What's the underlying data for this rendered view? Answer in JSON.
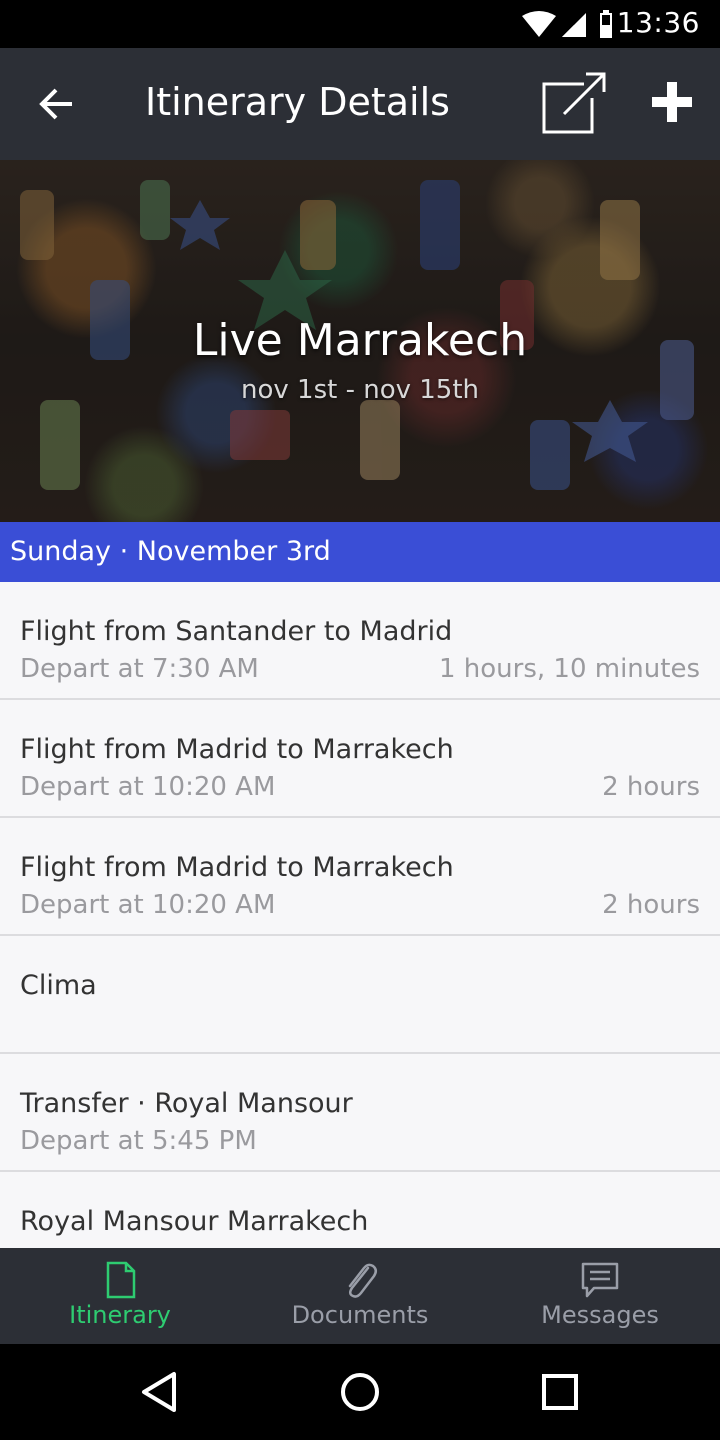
{
  "status_bar": {
    "time": "13:36",
    "icons": [
      "wifi-icon",
      "signal-icon",
      "battery-icon"
    ]
  },
  "app_bar": {
    "title": "Itinerary Details",
    "back_icon": "arrow-left-icon",
    "share_icon": "external-link-icon",
    "add_icon": "plus-icon"
  },
  "hero": {
    "title": "Live Marrakech",
    "dates": "nov 1st - nov 15th"
  },
  "day": {
    "label": "Sunday · November 3rd"
  },
  "items": [
    {
      "name": "Flight from Santander to Madrid",
      "depart": "Depart at 7:30 AM",
      "duration": "1 hours, 10 minutes"
    },
    {
      "name": "Flight from Madrid to Marrakech",
      "depart": "Depart at 10:20 AM",
      "duration": "2 hours"
    },
    {
      "name": "Flight from Madrid to Marrakech",
      "depart": "Depart at 10:20 AM",
      "duration": "2 hours"
    },
    {
      "name": "Clima",
      "depart": "",
      "duration": ""
    },
    {
      "name": "Transfer · Royal Mansour",
      "depart": "Depart at 5:45 PM",
      "duration": ""
    },
    {
      "name": "Royal Mansour Marrakech",
      "depart": "",
      "duration": ""
    }
  ],
  "tabs": [
    {
      "label": "Itinerary",
      "icon": "document-icon",
      "active": true
    },
    {
      "label": "Documents",
      "icon": "paperclip-icon",
      "active": false
    },
    {
      "label": "Messages",
      "icon": "chat-icon",
      "active": false
    }
  ],
  "colors": {
    "app_bar": "#2c2f36",
    "day_header": "#3a4ed6",
    "active_tab": "#2ecc71",
    "list_bg": "#f7f7f9"
  }
}
